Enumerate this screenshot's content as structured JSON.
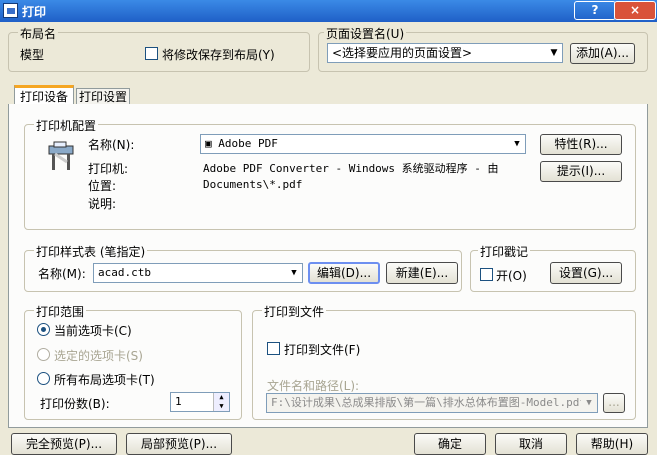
{
  "window": {
    "title": "打印",
    "help_btn": "?",
    "close_btn": "×"
  },
  "layout_name": {
    "group": "布局名",
    "value": "模型",
    "save_label": "将修改保存到布局(Y)"
  },
  "page_setup": {
    "group": "页面设置名(U)",
    "selected": "<选择要应用的页面设置>",
    "add": "添加(A)..."
  },
  "tabs": [
    "打印设备",
    "打印设置"
  ],
  "printer": {
    "group": "打印机配置",
    "name_label": "名称(N):",
    "name_value": "Adobe PDF",
    "properties": "特性(R)...",
    "hint": "提示(I)...",
    "printer_label": "打印机:",
    "printer_value": "Adobe PDF Converter - Windows 系统驱动程序 - 由",
    "location_label": "位置:",
    "location_value": "Documents\\*.pdf",
    "desc_label": "说明:"
  },
  "plot_style": {
    "group": "打印样式表 (笔指定)",
    "name_label": "名称(M):",
    "value": "acad.ctb",
    "edit": "编辑(D)...",
    "new": "新建(E)..."
  },
  "stamp": {
    "group": "打印戳记",
    "on_label": "开(O)",
    "settings": "设置(G)..."
  },
  "range": {
    "group": "打印范围",
    "options": [
      "当前选项卡(C)",
      "选定的选项卡(S)",
      "所有布局选项卡(T)"
    ],
    "copies_label": "打印份数(B):",
    "copies_value": "1"
  },
  "to_file": {
    "group": "打印到文件",
    "check_label": "打印到文件(F)",
    "path_label": "文件名和路径(L):",
    "path_value": "F:\\设计成果\\总成果排版\\第一篇\\排水总体布置图-Model.pdf",
    "browse": "..."
  },
  "bottom": {
    "full_preview": "完全预览(P)...",
    "partial_preview": "局部预览(P)...",
    "ok": "确定",
    "cancel": "取消",
    "help": "帮助(H)"
  }
}
